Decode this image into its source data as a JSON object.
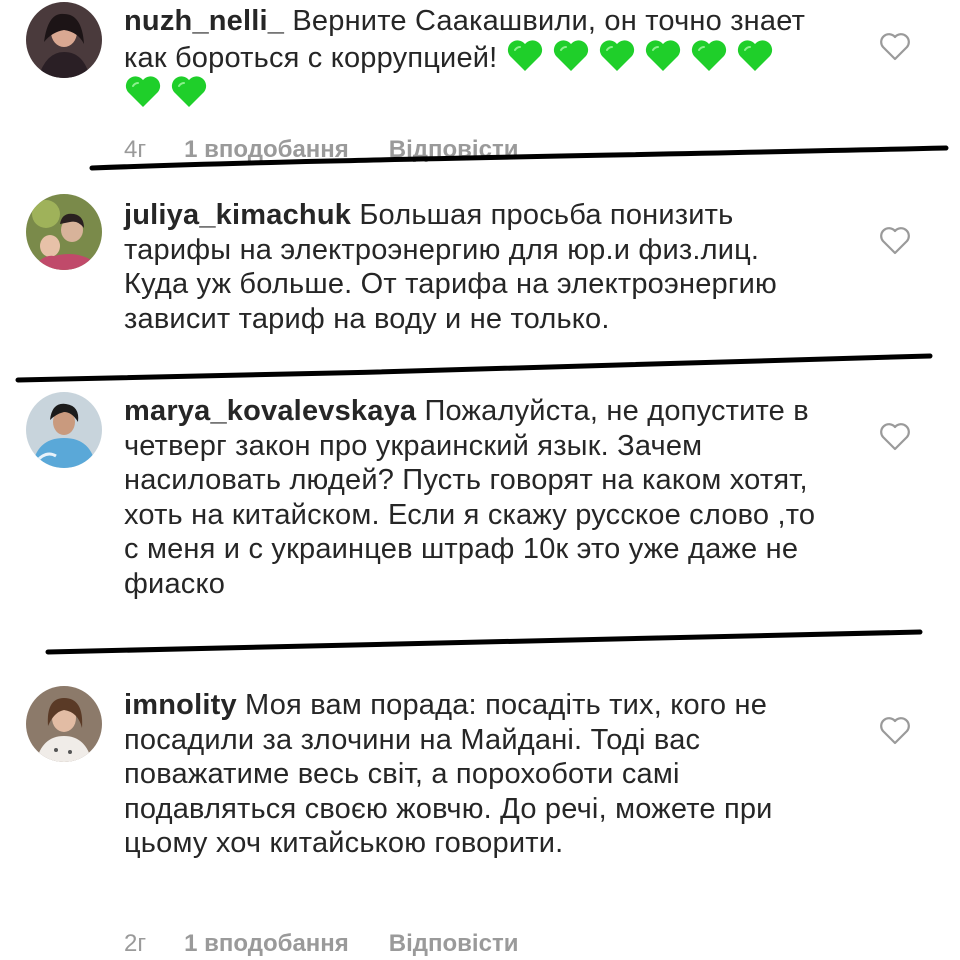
{
  "comments": [
    {
      "username": "nuzh_nelli_",
      "text": "Верните Саакашвили, он точно знает как бороться с коррупцией!",
      "emoji_icon": "green-heart-icon",
      "emoji_count": 8,
      "time": "4г",
      "likes": "1 вподобання",
      "reply": "Відповісти"
    },
    {
      "username": "juliya_kimachuk",
      "text": "Большая просьба понизить тарифы на электроэнергию для юр.и физ.лиц. Куда уж больше. От тарифа на электроэнергию зависит тариф на воду и не только."
    },
    {
      "username": "marya_kovalevskaya",
      "text": "Пожалуйста, не допустите в четверг закон про украинский язык. Зачем насиловать людей? Пусть говорят на каком хотят, хоть на китайском. Если я скажу русское слово ,то с меня и с украинцев штраф 10к это уже даже не фиаско"
    },
    {
      "username": "imnolity",
      "text": "Моя вам порада: посадіть тих, кого не посадили за злочини на Майдані. Тоді вас поважатиме весь світ, а порохоботи самі подавляться своєю жовчю. До речі, можете при цьому хоч китайською говорити.",
      "time": "2г",
      "likes": "1 вподобання",
      "reply": "Відповісти"
    }
  ],
  "icons": {
    "like": "heart-outline-icon",
    "emoji": "green-heart-icon"
  },
  "colors": {
    "text": "#262626",
    "meta": "#9a9a9a",
    "emoji_green": "#1fcf2a",
    "marker": "#000000"
  }
}
